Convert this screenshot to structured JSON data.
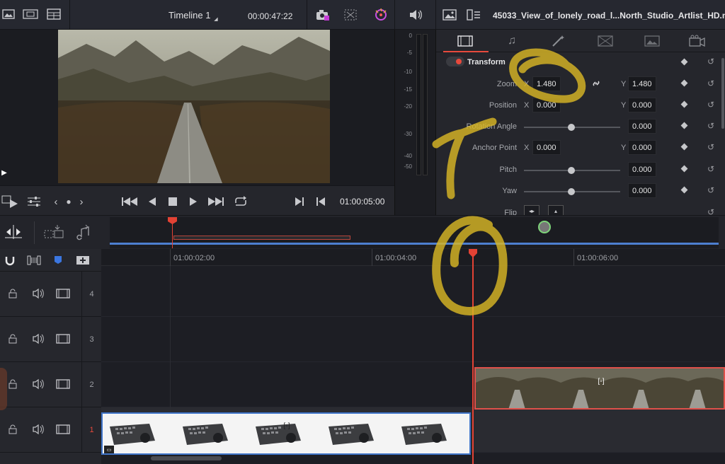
{
  "top_bar": {
    "timeline_name": "Timeline 1",
    "timecode": "00:00:47:22",
    "clip_name": "45033_View_of_lonely_road_l...North_Studio_Artlist_HD.mp4"
  },
  "transport": {
    "timecode": "01:00:05:00"
  },
  "audio_meter": {
    "ticks": [
      "0",
      "-5",
      "-10",
      "-15",
      "-20",
      "-30",
      "-40",
      "-50"
    ]
  },
  "inspector": {
    "section_title": "Transform",
    "zoom_label": "Zoom",
    "zoom_x_label": "X",
    "zoom_x": "1.480",
    "zoom_y_label": "Y",
    "zoom_y": "1.480",
    "position_label": "Position",
    "position_x_label": "X",
    "position_x": "0.000",
    "position_y_label": "Y",
    "position_y": "0.000",
    "rotation_label": "Rotation Angle",
    "rotation_value": "0.000",
    "anchor_label": "Anchor Point",
    "anchor_x_label": "X",
    "anchor_x": "0.000",
    "anchor_y_label": "Y",
    "anchor_y": "0.000",
    "pitch_label": "Pitch",
    "pitch_value": "0.000",
    "yaw_label": "Yaw",
    "yaw_value": "0.000",
    "flip_label": "Flip"
  },
  "timeline": {
    "ruler": [
      "01:00:02:00",
      "01:00:04:00",
      "01:00:06:00"
    ],
    "tracks": [
      "4",
      "3",
      "2",
      "1"
    ]
  },
  "colors": {
    "accent": "#e8493c",
    "scribble": "#d8b625",
    "playhead": "#e34234"
  }
}
